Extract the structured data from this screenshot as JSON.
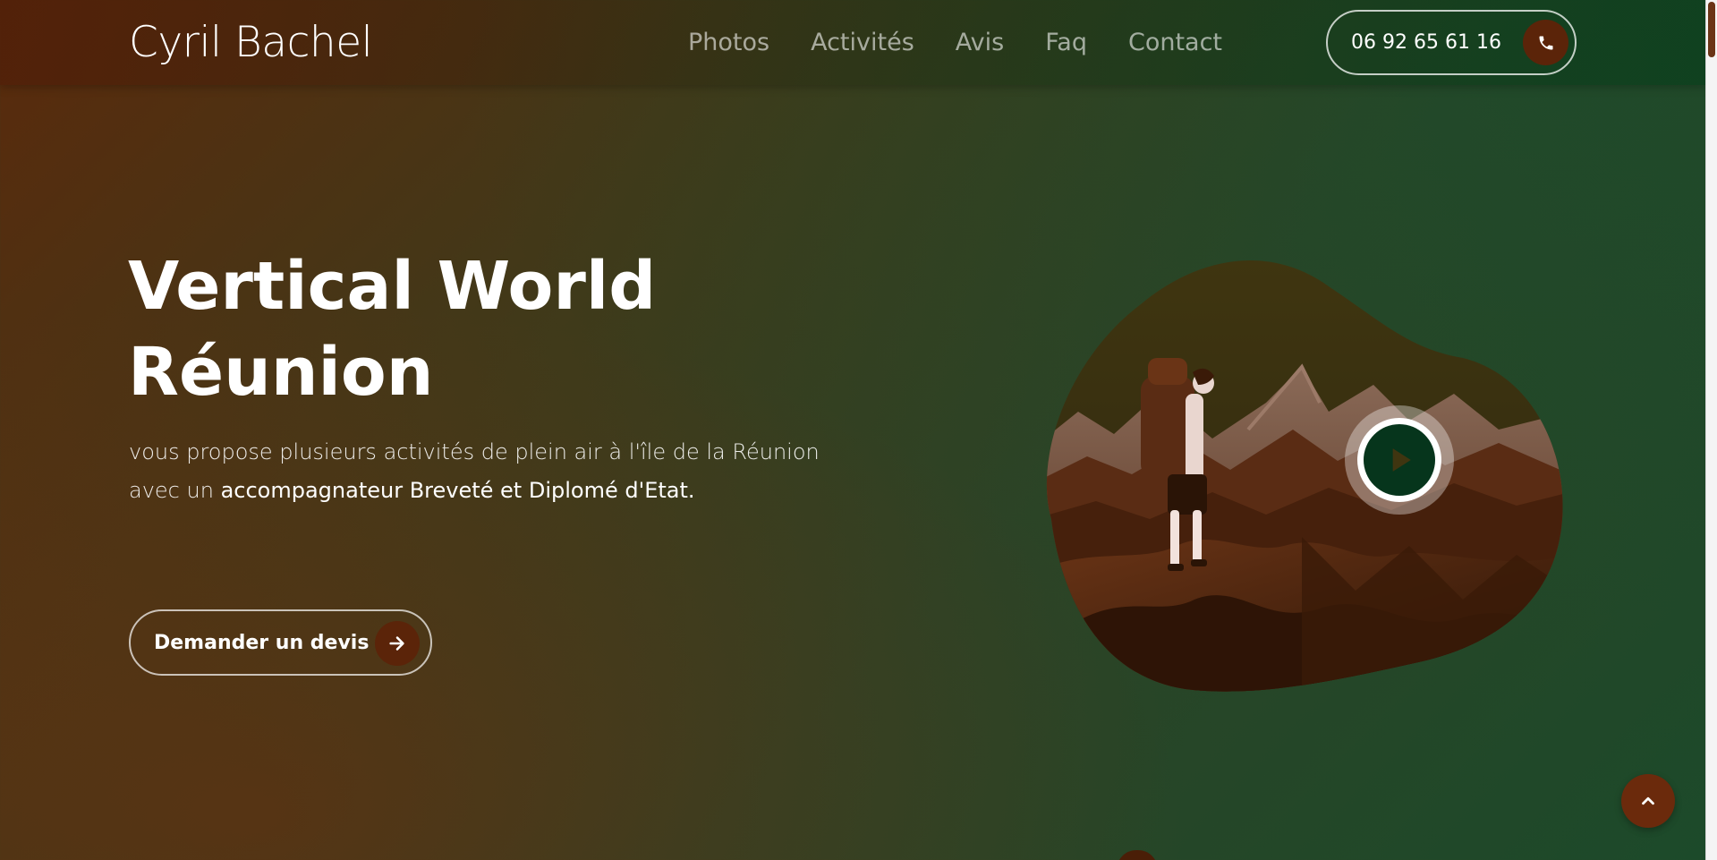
{
  "header": {
    "brand": "Cyril Bachel",
    "nav": [
      {
        "label": "Photos"
      },
      {
        "label": "Activités"
      },
      {
        "label": "Avis"
      },
      {
        "label": "Faq"
      },
      {
        "label": "Contact"
      }
    ],
    "phone": {
      "number": "06 92 65 61 16",
      "icon": "phone-icon"
    }
  },
  "hero": {
    "title_line1": "Vertical World",
    "title_line2": "Réunion",
    "text_part1": "vous propose plusieurs activités de plein air à l'île de la Réunion avec un ",
    "text_strong": "accompagnateur Breveté et Diplomé d'Etat.",
    "cta_label": "Demander un devis",
    "cta_icon": "arrow-right-icon"
  },
  "media": {
    "illustration": "hiker-on-mountain-illustration",
    "play_icon": "play-icon"
  },
  "floating": {
    "back_to_top_icon": "chevron-up-icon"
  },
  "colors": {
    "accent": "#5b2409",
    "play_core": "#06351c",
    "text": "#ffffff"
  }
}
